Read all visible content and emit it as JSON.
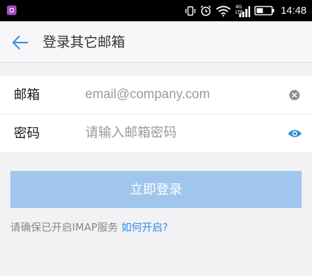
{
  "status_bar": {
    "network_type": "4G LTE",
    "time": "14:48",
    "icons": [
      "app-notification-icon",
      "vibrate-icon",
      "alarm-icon",
      "wifi-icon",
      "signal-icon",
      "battery-icon"
    ]
  },
  "header": {
    "title": "登录其它邮箱",
    "back_icon": "arrow-left-icon"
  },
  "form": {
    "email": {
      "label": "邮箱",
      "placeholder": "email@company.com",
      "value": "",
      "action_icon": "clear-icon"
    },
    "password": {
      "label": "密码",
      "placeholder": "请输入邮箱密码",
      "value": "",
      "action_icon": "eye-icon"
    }
  },
  "login_button": {
    "label": "立即登录",
    "enabled": false
  },
  "hint": {
    "text": "请确保已开启IMAP服务",
    "link": "如何开启?"
  },
  "colors": {
    "accent": "#2d8cf0",
    "button_disabled": "#a1c6ee",
    "background": "#f2f2f4"
  }
}
